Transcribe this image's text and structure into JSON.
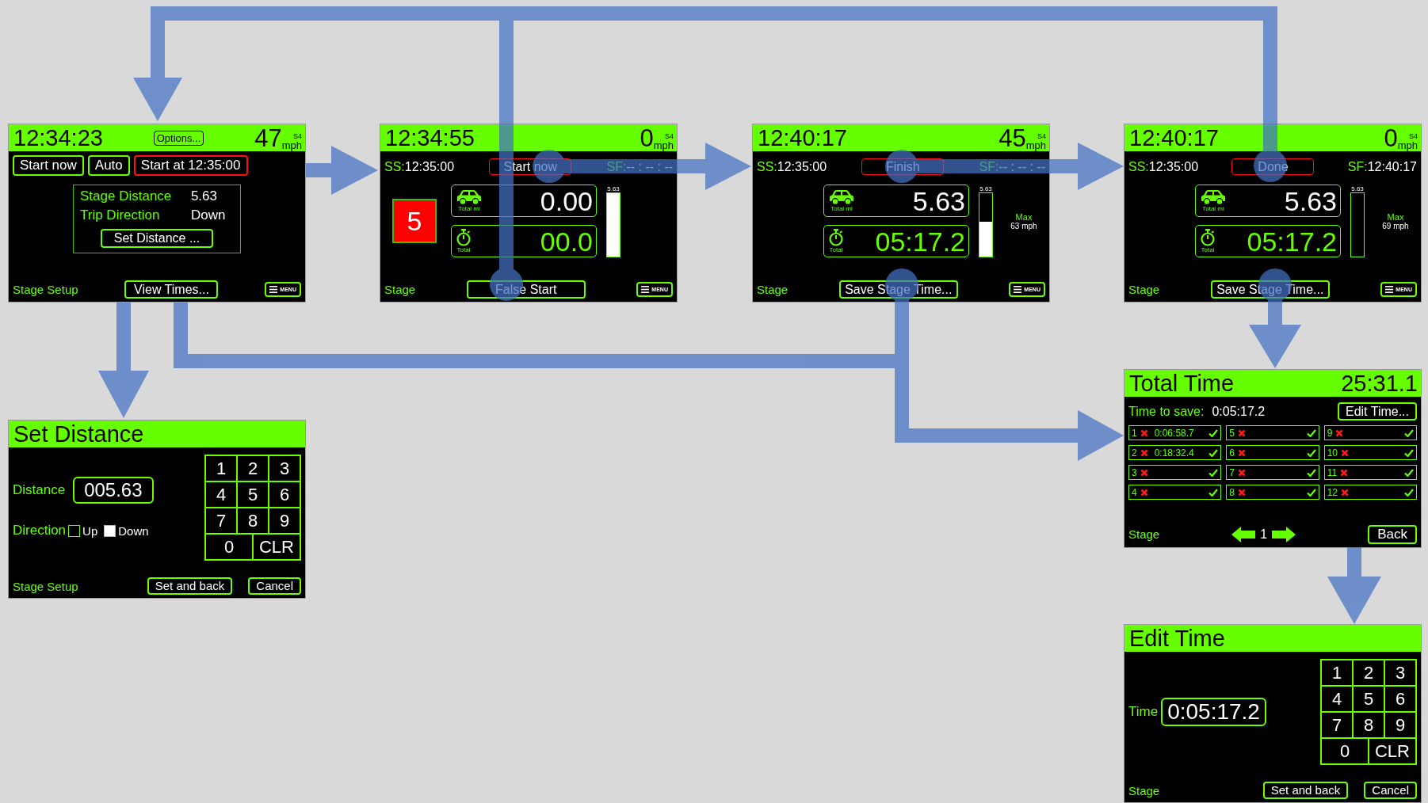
{
  "screens": [
    {
      "kind": "setup",
      "time": "12:34:23",
      "options_button": "Options...",
      "speed": "47",
      "speed_tag": "S4",
      "speed_unit": "mph",
      "start_buttons": [
        {
          "label": "Start now",
          "highlighted": false
        },
        {
          "label": "Auto",
          "highlighted": false
        },
        {
          "label": "Start at 12:35:00",
          "highlighted": true
        }
      ],
      "info": [
        {
          "label": "Stage Distance",
          "value": "5.63"
        },
        {
          "label": "Trip Direction",
          "value": "Down"
        }
      ],
      "set_distance_button": "Set Distance ...",
      "footer": "Stage Setup",
      "view_times_button": "View Times...",
      "menu_button": "MENU"
    },
    {
      "kind": "stage",
      "time": "12:34:55",
      "speed": "0",
      "speed_tag": "S4",
      "speed_unit": "mph",
      "ss_label": "SS:",
      "ss_value": "12:35:00",
      "action_button": "Start now",
      "sf_label": "SF:",
      "sf_value": "-- : -- : --",
      "countdown": "5",
      "distance": "0.00",
      "distance_label": "Total mi",
      "elapsed": "00.0",
      "elapsed_label": "Total",
      "bar_label": "5.63",
      "level": 1,
      "bottom_button": "False Start",
      "footer": "Stage",
      "menu_button": "MENU"
    },
    {
      "kind": "stage",
      "time": "12:40:17",
      "speed": "45",
      "speed_tag": "S4",
      "speed_unit": "mph",
      "ss_label": "SS:",
      "ss_value": "12:35:00",
      "action_button": "Finish",
      "sf_label": "SF:",
      "sf_value": "-- : -- : --",
      "distance": "5.63",
      "distance_label": "Total mi",
      "elapsed": "05:17.2",
      "elapsed_label": "Total",
      "bar_label": "5.63",
      "level": 0.55,
      "max_label": "Max",
      "max_value": "63 mph",
      "bottom_button": "Save Stage Time...",
      "footer": "Stage",
      "menu_button": "MENU"
    },
    {
      "kind": "stage",
      "time": "12:40:17",
      "speed": "0",
      "speed_tag": "S4",
      "speed_unit": "mph",
      "ss_label": "SS:",
      "ss_value": "12:35:00",
      "action_button": "Done",
      "sf_label": "SF:",
      "sf_value": "12:40:17",
      "distance": "5.63",
      "distance_label": "Total mi",
      "elapsed": "05:17.2",
      "elapsed_label": "Total",
      "bar_label": "5.63",
      "level": 0,
      "max_label": "Max",
      "max_value": "69 mph",
      "bottom_button": "Save Stage Time...",
      "footer": "Stage",
      "menu_button": "MENU"
    },
    {
      "kind": "times",
      "title": "Total Time",
      "total": "25:31.1",
      "save_label": "Time to save:",
      "save_value": "0:05:17.2",
      "edit_button": "Edit Time...",
      "slots": [
        {
          "number": "1",
          "time": "0:06:58.7"
        },
        {
          "number": "2",
          "time": "0:18:32.4"
        },
        {
          "number": "3"
        },
        {
          "number": "4"
        },
        {
          "number": "5"
        },
        {
          "number": "6"
        },
        {
          "number": "7"
        },
        {
          "number": "8"
        },
        {
          "number": "9"
        },
        {
          "number": "10"
        },
        {
          "number": "11"
        },
        {
          "number": "12"
        }
      ],
      "page": "1",
      "footer": "Stage",
      "back_button": "Back"
    },
    {
      "kind": "keypad",
      "title": "Set Distance",
      "field_label": "Distance",
      "value": "005.63",
      "direction_label": "Direction",
      "directions": [
        {
          "label": "Up",
          "checked": false
        },
        {
          "label": "Down",
          "checked": true
        }
      ],
      "keys": [
        "1",
        "2",
        "3",
        "4",
        "5",
        "6",
        "7",
        "8",
        "9",
        "0",
        "CLR"
      ],
      "footer": "Stage Setup",
      "buttons": [
        "Set and back",
        "Cancel"
      ]
    },
    {
      "kind": "keypad",
      "title": "Edit Time",
      "field_label": "Time",
      "value": "0:05:17.2",
      "keys": [
        "1",
        "2",
        "3",
        "4",
        "5",
        "6",
        "7",
        "8",
        "9",
        "0",
        "CLR"
      ],
      "footer": "Stage",
      "buttons": [
        "Set and back",
        "Cancel"
      ]
    }
  ]
}
